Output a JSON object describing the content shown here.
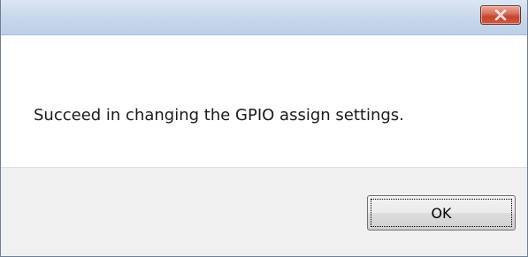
{
  "titlebar": {
    "title": "",
    "close_icon": "close-x-icon",
    "close_color": "#c4452f"
  },
  "content": {
    "message": "Succeed in changing the GPIO assign settings."
  },
  "footer": {
    "ok_label": "OK"
  }
}
